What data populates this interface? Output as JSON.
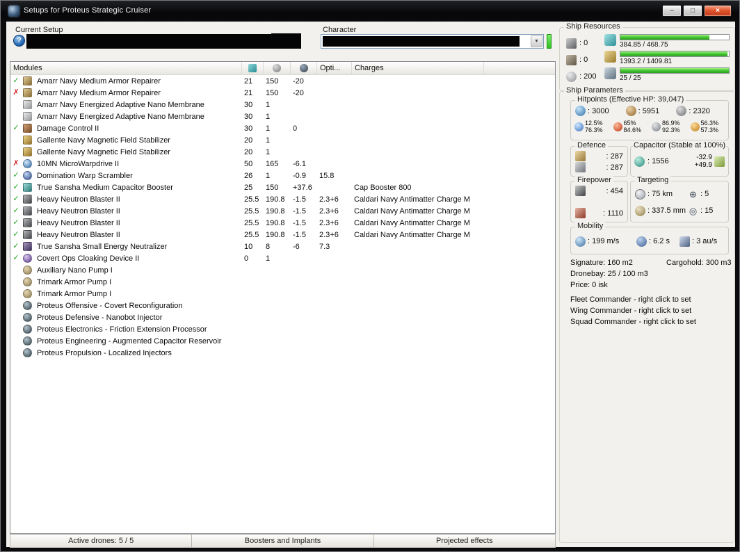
{
  "window": {
    "title": "Setups for Proteus Strategic Cruiser",
    "controls": {
      "minimize": "–",
      "maximize": "□",
      "close": "×"
    }
  },
  "setup": {
    "label": "Current Setup",
    "help": "?"
  },
  "character": {
    "label": "Character"
  },
  "modules": {
    "header": {
      "title": "Modules",
      "opti": "Opti...",
      "charges": "Charges"
    },
    "rows": [
      {
        "status": "ok",
        "icon": "armor-repairer",
        "name": "Amarr Navy Medium Armor Repairer",
        "cpu": "21",
        "pg": "150",
        "cap": "-20",
        "opti": "",
        "charge": ""
      },
      {
        "status": "off",
        "icon": "armor-repairer",
        "name": "Amarr Navy Medium Armor Repairer",
        "cpu": "21",
        "pg": "150",
        "cap": "-20",
        "opti": "",
        "charge": ""
      },
      {
        "status": "none",
        "icon": "membrane",
        "name": "Amarr Navy Energized Adaptive Nano Membrane",
        "cpu": "30",
        "pg": "1",
        "cap": "",
        "opti": "",
        "charge": ""
      },
      {
        "status": "none",
        "icon": "membrane",
        "name": "Amarr Navy Energized Adaptive Nano Membrane",
        "cpu": "30",
        "pg": "1",
        "cap": "",
        "opti": "",
        "charge": ""
      },
      {
        "status": "ok",
        "icon": "damage-control",
        "name": "Damage Control II",
        "cpu": "30",
        "pg": "1",
        "cap": "0",
        "opti": "",
        "charge": ""
      },
      {
        "status": "none",
        "icon": "mag-stab",
        "name": "Gallente Navy Magnetic Field Stabilizer",
        "cpu": "20",
        "pg": "1",
        "cap": "",
        "opti": "",
        "charge": ""
      },
      {
        "status": "none",
        "icon": "mag-stab",
        "name": "Gallente Navy Magnetic Field Stabilizer",
        "cpu": "20",
        "pg": "1",
        "cap": "",
        "opti": "",
        "charge": ""
      },
      {
        "status": "off",
        "icon": "mwd",
        "name": "10MN MicroWarpdrive II",
        "cpu": "50",
        "pg": "165",
        "cap": "-6.1",
        "opti": "",
        "charge": ""
      },
      {
        "status": "ok",
        "icon": "scrambler",
        "name": "Domination Warp Scrambler",
        "cpu": "26",
        "pg": "1",
        "cap": "-0.9",
        "opti": "15.8",
        "charge": ""
      },
      {
        "status": "ok",
        "icon": "cap-booster",
        "name": "True Sansha Medium Capacitor Booster",
        "cpu": "25",
        "pg": "150",
        "cap": "+37.6",
        "opti": "",
        "charge": "Cap Booster 800"
      },
      {
        "status": "ok",
        "icon": "blaster",
        "name": "Heavy Neutron Blaster II",
        "cpu": "25.5",
        "pg": "190.8",
        "cap": "-1.5",
        "opti": "2.3+6",
        "charge": "Caldari Navy Antimatter Charge M"
      },
      {
        "status": "ok",
        "icon": "blaster",
        "name": "Heavy Neutron Blaster II",
        "cpu": "25.5",
        "pg": "190.8",
        "cap": "-1.5",
        "opti": "2.3+6",
        "charge": "Caldari Navy Antimatter Charge M"
      },
      {
        "status": "ok",
        "icon": "blaster",
        "name": "Heavy Neutron Blaster II",
        "cpu": "25.5",
        "pg": "190.8",
        "cap": "-1.5",
        "opti": "2.3+6",
        "charge": "Caldari Navy Antimatter Charge M"
      },
      {
        "status": "ok",
        "icon": "blaster",
        "name": "Heavy Neutron Blaster II",
        "cpu": "25.5",
        "pg": "190.8",
        "cap": "-1.5",
        "opti": "2.3+6",
        "charge": "Caldari Navy Antimatter Charge M"
      },
      {
        "status": "ok",
        "icon": "neutralizer",
        "name": "True Sansha Small Energy Neutralizer",
        "cpu": "10",
        "pg": "8",
        "cap": "-6",
        "opti": "7.3",
        "charge": ""
      },
      {
        "status": "ok",
        "icon": "cloak",
        "name": "Covert Ops Cloaking Device II",
        "cpu": "0",
        "pg": "1",
        "cap": "",
        "opti": "",
        "charge": ""
      },
      {
        "status": "none",
        "icon": "rig",
        "name": "Auxiliary Nano Pump I",
        "cpu": "",
        "pg": "",
        "cap": "",
        "opti": "",
        "charge": ""
      },
      {
        "status": "none",
        "icon": "rig",
        "name": "Trimark Armor Pump I",
        "cpu": "",
        "pg": "",
        "cap": "",
        "opti": "",
        "charge": ""
      },
      {
        "status": "none",
        "icon": "rig",
        "name": "Trimark Armor Pump I",
        "cpu": "",
        "pg": "",
        "cap": "",
        "opti": "",
        "charge": ""
      },
      {
        "status": "none",
        "icon": "subsystem",
        "name": "Proteus Offensive - Covert Reconfiguration",
        "cpu": "",
        "pg": "",
        "cap": "",
        "opti": "",
        "charge": ""
      },
      {
        "status": "none",
        "icon": "subsystem",
        "name": "Proteus Defensive - Nanobot Injector",
        "cpu": "",
        "pg": "",
        "cap": "",
        "opti": "",
        "charge": ""
      },
      {
        "status": "none",
        "icon": "subsystem",
        "name": "Proteus Electronics - Friction Extension Processor",
        "cpu": "",
        "pg": "",
        "cap": "",
        "opti": "",
        "charge": ""
      },
      {
        "status": "none",
        "icon": "subsystem",
        "name": "Proteus Engineering - Augmented Capacitor Reservoir",
        "cpu": "",
        "pg": "",
        "cap": "",
        "opti": "",
        "charge": ""
      },
      {
        "status": "none",
        "icon": "subsystem",
        "name": "Proteus Propulsion - Localized Injectors",
        "cpu": "",
        "pg": "",
        "cap": "",
        "opti": "",
        "charge": ""
      }
    ]
  },
  "tabs": [
    {
      "label": "Active drones: 5 / 5"
    },
    {
      "label": "Boosters and Implants"
    },
    {
      "label": "Projected effects"
    }
  ],
  "resources": {
    "title": "Ship Resources",
    "turrets": ": 0",
    "launchers": ": 0",
    "calibration": ": 200",
    "bars": {
      "cpu": {
        "text": "384.85 / 468.75",
        "pct": 82
      },
      "powergrid": {
        "text": "1393.2 / 1409.81",
        "pct": 99
      },
      "drone_bandwidth": {
        "text": "25 / 25",
        "pct": 100
      }
    }
  },
  "parameters": {
    "title": "Ship Parameters",
    "hitpoints": {
      "title": "Hitpoints (Effective HP: 39,047)",
      "shield": ": 3000",
      "armor": ": 5951",
      "hull": ": 2320",
      "resists": {
        "em": {
          "shield": "12.5%",
          "armor": "76.3%"
        },
        "thermal": {
          "shield": "65%",
          "armor": "84.6%"
        },
        "kinetic": {
          "shield": "86.9%",
          "armor": "92.3%"
        },
        "explosive": {
          "shield": "56.3%",
          "armor": "57.3%"
        }
      }
    },
    "defence": {
      "title": "Defence",
      "repair": ": 287",
      "sustained": ": 287"
    },
    "capacitor": {
      "title": "Capacitor (Stable at 100%)",
      "capacity": ": 1556",
      "usage": "-32.9",
      "recharge": "+49.9"
    },
    "firepower": {
      "title": "Firepower",
      "dps": ": 454",
      "volley": ": 1110"
    },
    "targeting": {
      "title": "Targeting",
      "range": ": 75 km",
      "max_targets": ": 5",
      "scan_resolution": ": 337.5 mm",
      "sensor_strength": ": 15"
    },
    "mobility": {
      "title": "Mobility",
      "max_velocity": ": 199 m/s",
      "align_time": ": 6.2 s",
      "warp_speed": ": 3 au/s"
    },
    "stats": {
      "signature": "Signature: 160 m2",
      "cargohold": "Cargohold: 300 m3",
      "dronebay": "Dronebay: 25 / 100 m3",
      "price": "Price: 0 isk"
    },
    "commanders": {
      "fleet": "Fleet Commander - right click to set",
      "wing": "Wing Commander - right click to set",
      "squad": "Squad Commander - right click to set"
    }
  }
}
